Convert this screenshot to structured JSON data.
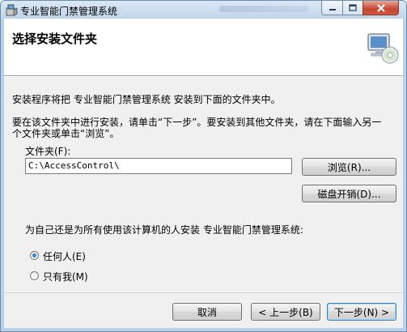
{
  "window": {
    "title": "专业智能门禁管理系统",
    "min_icon": "minimize-icon",
    "max_icon": "maximize-icon",
    "close_icon": "close-icon"
  },
  "header": {
    "title": "选择安装文件夹",
    "icon": "computer-cd-icon"
  },
  "body": {
    "intro": "安装程序将把 专业智能门禁管理系统 安装到下面的文件夹中。",
    "instruction_line1": "要在该文件夹中进行安装，请单击“下一步”。要安装到其他文件夹，请在下面输入另一",
    "instruction_line2": "个文件夹或单击“浏览”。",
    "folder_label": "文件夹(F):",
    "folder_value": "C:\\AccessControl\\",
    "browse_button": "浏览(R)...",
    "disk_cost_button": "磁盘开销(D)...",
    "install_for_question": "为自己还是为所有使用该计算机的人安装 专业智能门禁管理系统:",
    "option_everyone": "任何人(E)",
    "option_just_me": "只有我(M)",
    "selected_option": "everyone"
  },
  "footer": {
    "cancel": "取消",
    "back": "< 上一步(B)",
    "next": "下一步(N) >"
  },
  "colors": {
    "title_bar": "#c0d5ea",
    "client_bg": "#f0f0f0",
    "close_red": "#c6452f",
    "radio_selected": "#1a5aa0"
  }
}
